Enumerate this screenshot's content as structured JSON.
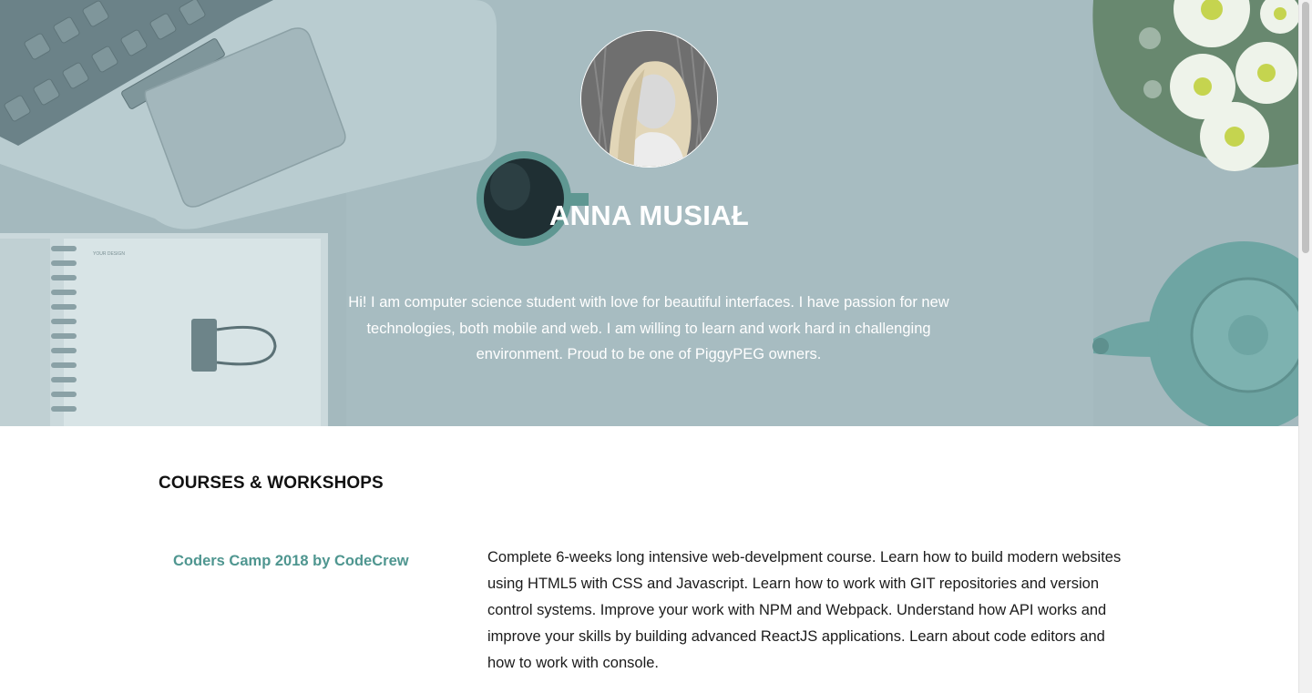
{
  "hero": {
    "name": "ANNA MUSIAŁ",
    "bio": "Hi! I am computer science student with love for beautiful interfaces. I have passion for new technologies, both mobile and web. I am willing to learn and work hard in challenging environment. Proud to be one of PiggyPEG owners.",
    "notebook_label": "YOUR DESIGN"
  },
  "courses": {
    "title": "COURSES & WORKSHOPS",
    "items": [
      {
        "name": "Coders Camp 2018 by CodeCrew",
        "description": "Complete 6-weeks long intensive web-develpment course. Learn how to build modern websites using HTML5 with CSS and Javascript. Learn how to work with GIT repositories and version control systems. Improve your work with NPM and Webpack. Understand how API works and improve your skills by building advanced ReactJS applications. Learn about code editors and how to work with console."
      }
    ]
  },
  "colors": {
    "accent": "#4f9690",
    "hero_overlay": "#a3b8bd",
    "text_dark": "#1b1b1b"
  },
  "icons": {
    "avatar": "profile-photo"
  }
}
